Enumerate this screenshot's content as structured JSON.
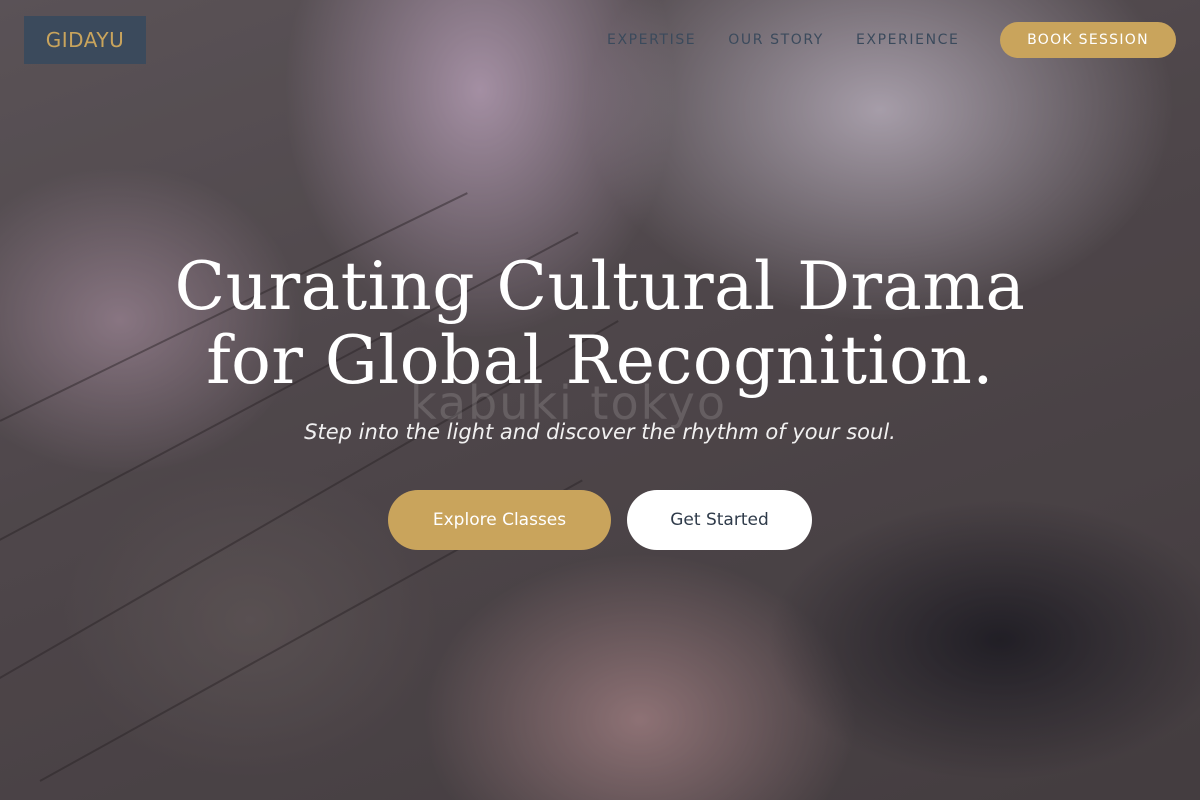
{
  "brand": {
    "logo_text": "GIDAYU"
  },
  "nav": {
    "links": [
      {
        "label": "EXPERTISE"
      },
      {
        "label": "OUR STORY"
      },
      {
        "label": "EXPERIENCE"
      }
    ],
    "book_label": "BOOK SESSION"
  },
  "hero": {
    "headline_line1": "Curating Cultural Drama",
    "headline_line2": "for Global Recognition.",
    "subline": "Step into the light and discover the rhythm of your soul.",
    "watermark": "kabuki tokyo",
    "primary_cta": "Explore Classes",
    "secondary_cta": "Get Started"
  },
  "colors": {
    "accent_gold": "#c9a45c",
    "navy": "#3b4a5c",
    "white": "#ffffff"
  }
}
